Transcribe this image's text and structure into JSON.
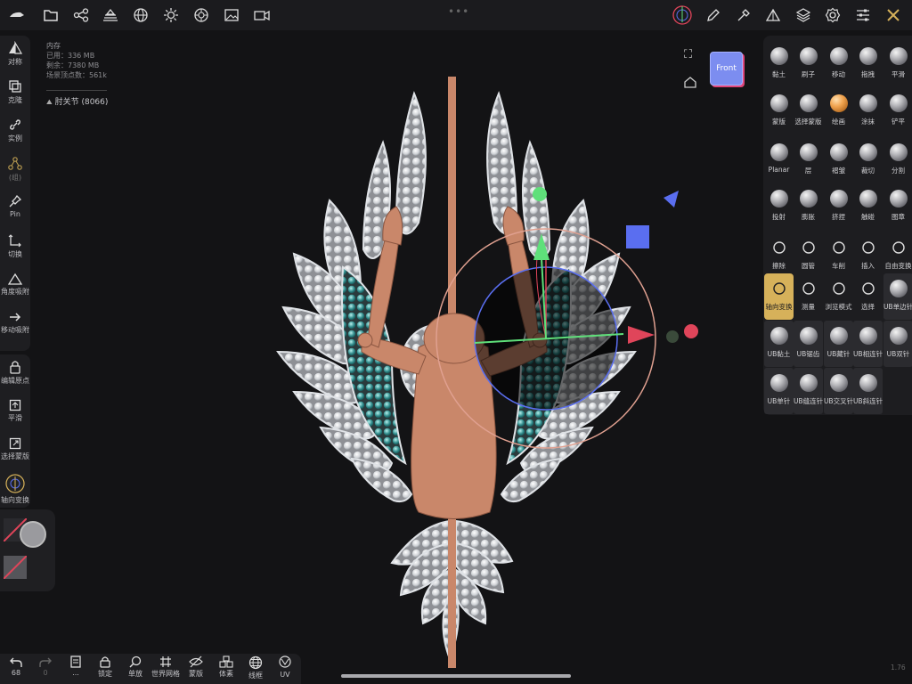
{
  "colors": {
    "accent": "#d6b15a",
    "background": "#131315",
    "panel": "#1e1e21",
    "gizmo_x": "#e0455a",
    "gizmo_y": "#5fe07a",
    "gizmo_z": "#5a6ef0",
    "skin": "#c9876a"
  },
  "topbar": {
    "icons": [
      "menu-logo-icon",
      "folder-icon",
      "share-nodes-icon",
      "scene-stack-icon",
      "globe-icon",
      "sun-icon",
      "material-ball-icon",
      "image-icon",
      "video-camera-icon",
      "gizmo-sphere-icon",
      "pen-icon",
      "eyedropper-icon",
      "triangle-icon",
      "layers-icon",
      "settings-gear-icon",
      "sliders-icon",
      "tools-cross-icon"
    ]
  },
  "stats": {
    "title": "内存",
    "used": "已用：336 MB",
    "free": "剩余：7380 MB",
    "scene_vertices": "场景顶点数：561k",
    "joint": "肘关节 (8066)"
  },
  "view_cube": {
    "label": "Front"
  },
  "left_toolbar": [
    {
      "label": "对称",
      "icon": "symmetry-icon"
    },
    {
      "label": "克隆",
      "icon": "clone-icon"
    },
    {
      "label": "实例",
      "icon": "link-icon"
    },
    {
      "label": "(组)",
      "icon": "group-nodes-icon"
    },
    {
      "label": "Pin",
      "icon": "pin-icon"
    },
    {
      "label": "切换",
      "icon": "toggle-axis-icon"
    },
    {
      "label": "角度吸附",
      "icon": "angle-snap-icon"
    },
    {
      "label": "移动吸附",
      "icon": "move-snap-icon"
    },
    {
      "label": "编辑原点",
      "icon": "lock-icon"
    },
    {
      "label": "平滑",
      "icon": "smooth-icon"
    },
    {
      "label": "选择蒙版",
      "icon": "mask-select-icon"
    },
    {
      "label": "轴向变换",
      "icon": "axis-transform-icon"
    }
  ],
  "right_tools": [
    [
      {
        "label": "黏土"
      },
      {
        "label": "刷子"
      },
      {
        "label": "移动"
      },
      {
        "label": "拖拽"
      },
      {
        "label": "平滑"
      }
    ],
    [
      {
        "label": "蒙版"
      },
      {
        "label": "选择蒙版"
      },
      {
        "label": "绘画"
      },
      {
        "label": "涂抹"
      },
      {
        "label": "铲平"
      }
    ],
    [
      {
        "label": "Planar"
      },
      {
        "label": "层"
      },
      {
        "label": "褶皱"
      },
      {
        "label": "裁切"
      },
      {
        "label": "分割"
      }
    ],
    [
      {
        "label": "投射"
      },
      {
        "label": "膨胀"
      },
      {
        "label": "挤捏"
      },
      {
        "label": "触碰"
      },
      {
        "label": "图章"
      }
    ],
    [
      {
        "label": "擦除"
      },
      {
        "label": "圆管"
      },
      {
        "label": "车削"
      },
      {
        "label": "插入"
      },
      {
        "label": "自由变换"
      }
    ],
    [
      {
        "label": "轴向变换"
      },
      {
        "label": "测量"
      },
      {
        "label": "浏览模式"
      },
      {
        "label": "选择"
      },
      {
        "label": "UB单边针"
      }
    ],
    [
      {
        "label": "UB黏土"
      },
      {
        "label": "UB锯齿"
      },
      {
        "label": "UB藏针"
      },
      {
        "label": "UB相连针"
      },
      {
        "label": "UB双针"
      }
    ],
    [
      {
        "label": "UB单针"
      },
      {
        "label": "UB缝连针"
      },
      {
        "label": "UB交叉针"
      },
      {
        "label": "UB斜连针"
      }
    ]
  ],
  "bottom_toolbar": [
    {
      "label": "68",
      "icon": "undo-icon"
    },
    {
      "label": "0",
      "icon": "redo-icon"
    },
    {
      "label": "...",
      "icon": "file-icon"
    },
    {
      "label": "锁定",
      "icon": "lock-icon"
    },
    {
      "label": "单放",
      "icon": "zoom-icon"
    },
    {
      "label": "世界网格",
      "icon": "grid-icon"
    },
    {
      "label": "蒙版",
      "icon": "hide-mask-icon"
    },
    {
      "label": "体素",
      "icon": "voxel-icon"
    },
    {
      "label": "线框",
      "icon": "wireframe-icon"
    },
    {
      "label": "UV",
      "icon": "uv-icon"
    }
  ],
  "fps": "1.76"
}
